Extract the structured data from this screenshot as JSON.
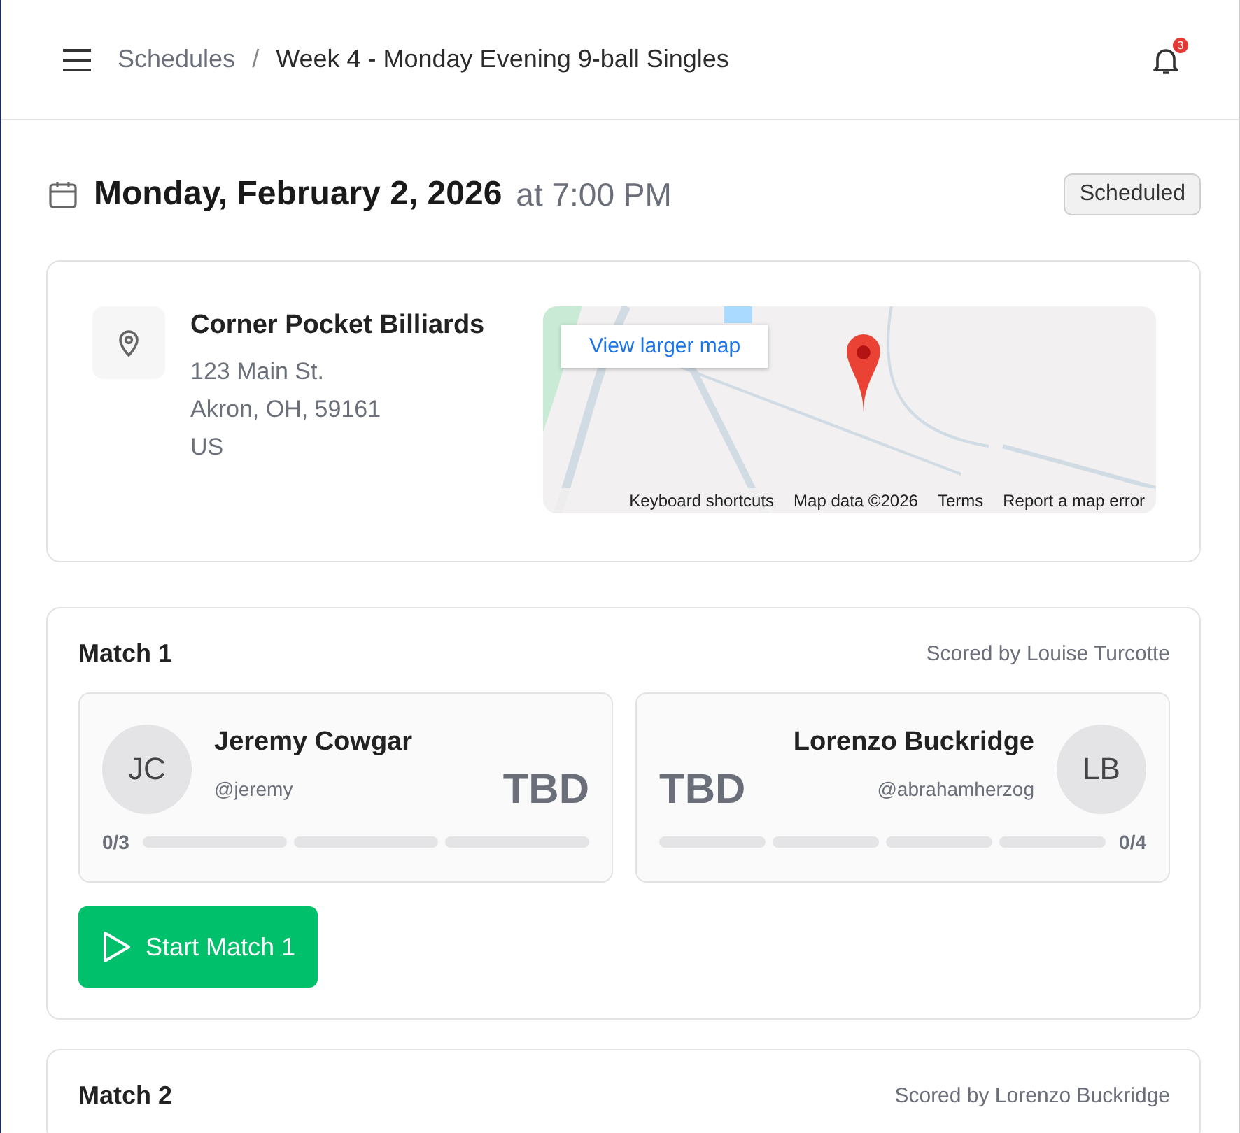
{
  "header": {
    "breadcrumb": [
      {
        "label": "Schedules",
        "current": false
      },
      {
        "label": "Week 4 - Monday Evening 9-ball Singles",
        "current": true
      }
    ],
    "separator": "/",
    "notifications": "3"
  },
  "schedule": {
    "date": "Monday, February 2, 2026",
    "time": "at 7:00 PM",
    "status": "Scheduled"
  },
  "venue": {
    "name": "Corner Pocket Billiards",
    "address": [
      "123 Main St.",
      "Akron, OH, 59161",
      "US"
    ],
    "map": {
      "kind": "picture",
      "button": "View larger map",
      "footer": [
        "Keyboard shortcuts",
        "Map data ©2026",
        "Terms",
        "Report a map error"
      ]
    }
  },
  "matches": [
    {
      "title": "Match 1",
      "scorer": "Scored by Louise Turcotte",
      "players": [
        {
          "initials": "JC",
          "name": "Jeremy Cowgar",
          "handle": "@jeremy",
          "score": "TBD",
          "progress": "0/3",
          "games": [
            {
              "won": false
            },
            {
              "won": false
            },
            {
              "won": false
            }
          ]
        },
        {
          "initials": "LB",
          "name": "Lorenzo Buckridge",
          "handle": "@abrahamherzog",
          "score": "TBD",
          "progress": "0/4",
          "games": [
            {
              "won": false
            },
            {
              "won": false
            },
            {
              "won": false
            },
            {
              "won": false
            }
          ]
        }
      ],
      "action": "Start Match 1"
    },
    {
      "title": "Match 2",
      "scorer": "Scored by Lorenzo Buckridge"
    }
  ]
}
